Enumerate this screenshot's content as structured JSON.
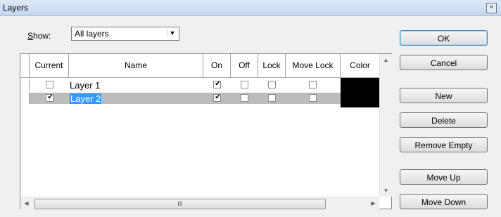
{
  "window": {
    "title": "Layers",
    "close_glyph": "×"
  },
  "show": {
    "label_accel": "S",
    "label_rest": "how:",
    "selected": "All layers"
  },
  "grid": {
    "columns": [
      "Current",
      "Name",
      "On",
      "Off",
      "Lock",
      "Move Lock",
      "Color"
    ],
    "rows": [
      {
        "current": false,
        "name": "Layer 1",
        "on": true,
        "off": false,
        "lock": false,
        "move_lock": false,
        "selected": false
      },
      {
        "current": true,
        "name": "Layer 2",
        "on": true,
        "off": false,
        "lock": false,
        "move_lock": false,
        "selected": true
      }
    ],
    "color_swatch": "#000000",
    "hscroll_thumb_glyph": "III"
  },
  "buttons": {
    "ok": "OK",
    "cancel": "Cancel",
    "new": "New",
    "delete": "Delete",
    "remove_empty": "Remove Empty",
    "move_up": "Move Up",
    "move_down": "Move Down"
  },
  "colors": {
    "selection": "#3399ff",
    "row_selected_bg": "#bcbcbc"
  }
}
